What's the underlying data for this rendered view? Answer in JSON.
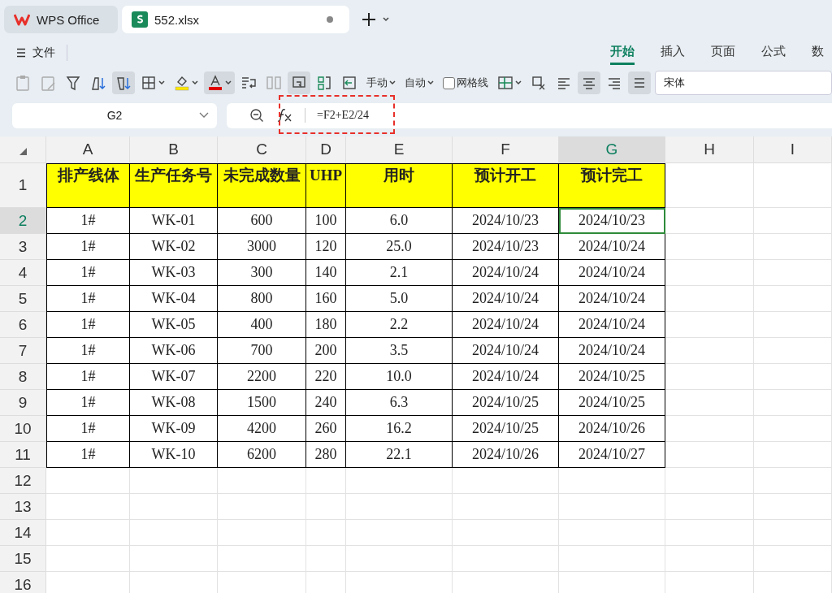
{
  "tabs": [
    {
      "label": "WPS Office",
      "selected": false,
      "unsaved": false
    },
    {
      "label": "552.xlsx",
      "selected": true,
      "unsaved": true
    }
  ],
  "menu": {
    "file": "文件",
    "ribbon_tabs": [
      {
        "label": "开始",
        "selected": true
      },
      {
        "label": "插入",
        "selected": false
      },
      {
        "label": "页面",
        "selected": false
      },
      {
        "label": "公式",
        "selected": false
      },
      {
        "label": "数",
        "selected": false
      }
    ]
  },
  "toolbar": [
    {
      "kind": "icon",
      "pressed": false
    },
    {
      "kind": "icon",
      "pressed": false
    },
    {
      "kind": "icon",
      "pressed": false
    },
    {
      "kind": "icon",
      "pressed": false
    },
    {
      "kind": "icon",
      "pressed": true
    },
    {
      "kind": "icon",
      "pressed": false
    },
    {
      "kind": "icon",
      "pressed": false
    },
    {
      "kind": "icon",
      "pressed": true
    },
    {
      "kind": "icon",
      "pressed": false
    },
    {
      "kind": "icon",
      "pressed": false
    },
    {
      "kind": "icon",
      "pressed": true
    },
    {
      "kind": "icon",
      "pressed": false
    },
    {
      "kind": "icon",
      "pressed": false
    },
    {
      "kind": "dropdown",
      "label": "手动"
    },
    {
      "kind": "dropdown",
      "label": "自动"
    },
    {
      "kind": "checkbox",
      "label": "网格线",
      "checked": false
    },
    {
      "kind": "icon",
      "pressed": false
    },
    {
      "kind": "icon",
      "pressed": false
    },
    {
      "kind": "icon",
      "pressed": false
    },
    {
      "kind": "icon",
      "pressed": true
    },
    {
      "kind": "icon",
      "pressed": false
    },
    {
      "kind": "icon",
      "pressed": true
    },
    {
      "kind": "font",
      "value": "宋体"
    }
  ],
  "name_box": "G2",
  "formula": "=F2+E2/24",
  "annotations": [
    {
      "kind": "dashed-box"
    }
  ],
  "sheet": {
    "columns": [
      {
        "label": "A",
        "selected": false
      },
      {
        "label": "B",
        "selected": false
      },
      {
        "label": "C",
        "selected": false
      },
      {
        "label": "D",
        "selected": false
      },
      {
        "label": "E",
        "selected": false
      },
      {
        "label": "F",
        "selected": false
      },
      {
        "label": "G",
        "selected": true
      },
      {
        "label": "H",
        "selected": false
      },
      {
        "label": "I",
        "selected": false
      }
    ],
    "rows": [
      {
        "label": "1",
        "kind": "header",
        "selected": false,
        "cells": [
          "排产线体",
          "生产任务号",
          "未完成数量",
          "UHP",
          "用时",
          "预计开工",
          "预计完工"
        ]
      },
      {
        "label": "2",
        "kind": "data",
        "selected": true,
        "cells": [
          "1#",
          "WK-01",
          "600",
          "100",
          "6.0",
          "2024/10/23",
          "2024/10/23"
        ]
      },
      {
        "label": "3",
        "kind": "data",
        "selected": false,
        "cells": [
          "1#",
          "WK-02",
          "3000",
          "120",
          "25.0",
          "2024/10/23",
          "2024/10/24"
        ]
      },
      {
        "label": "4",
        "kind": "data",
        "selected": false,
        "cells": [
          "1#",
          "WK-03",
          "300",
          "140",
          "2.1",
          "2024/10/24",
          "2024/10/24"
        ]
      },
      {
        "label": "5",
        "kind": "data",
        "selected": false,
        "cells": [
          "1#",
          "WK-04",
          "800",
          "160",
          "5.0",
          "2024/10/24",
          "2024/10/24"
        ]
      },
      {
        "label": "6",
        "kind": "data",
        "selected": false,
        "cells": [
          "1#",
          "WK-05",
          "400",
          "180",
          "2.2",
          "2024/10/24",
          "2024/10/24"
        ]
      },
      {
        "label": "7",
        "kind": "data",
        "selected": false,
        "cells": [
          "1#",
          "WK-06",
          "700",
          "200",
          "3.5",
          "2024/10/24",
          "2024/10/24"
        ]
      },
      {
        "label": "8",
        "kind": "data",
        "selected": false,
        "cells": [
          "1#",
          "WK-07",
          "2200",
          "220",
          "10.0",
          "2024/10/24",
          "2024/10/25"
        ]
      },
      {
        "label": "9",
        "kind": "data",
        "selected": false,
        "cells": [
          "1#",
          "WK-08",
          "1500",
          "240",
          "6.3",
          "2024/10/25",
          "2024/10/25"
        ]
      },
      {
        "label": "10",
        "kind": "data",
        "selected": false,
        "cells": [
          "1#",
          "WK-09",
          "4200",
          "260",
          "16.2",
          "2024/10/25",
          "2024/10/26"
        ]
      },
      {
        "label": "11",
        "kind": "data",
        "selected": false,
        "cells": [
          "1#",
          "WK-10",
          "6200",
          "280",
          "22.1",
          "2024/10/26",
          "2024/10/27"
        ]
      },
      {
        "label": "12",
        "kind": "empty",
        "selected": false
      },
      {
        "label": "13",
        "kind": "empty",
        "selected": false
      },
      {
        "label": "14",
        "kind": "empty",
        "selected": false
      },
      {
        "label": "15",
        "kind": "empty",
        "selected": false
      },
      {
        "label": "16",
        "kind": "empty",
        "selected": false
      }
    ]
  }
}
